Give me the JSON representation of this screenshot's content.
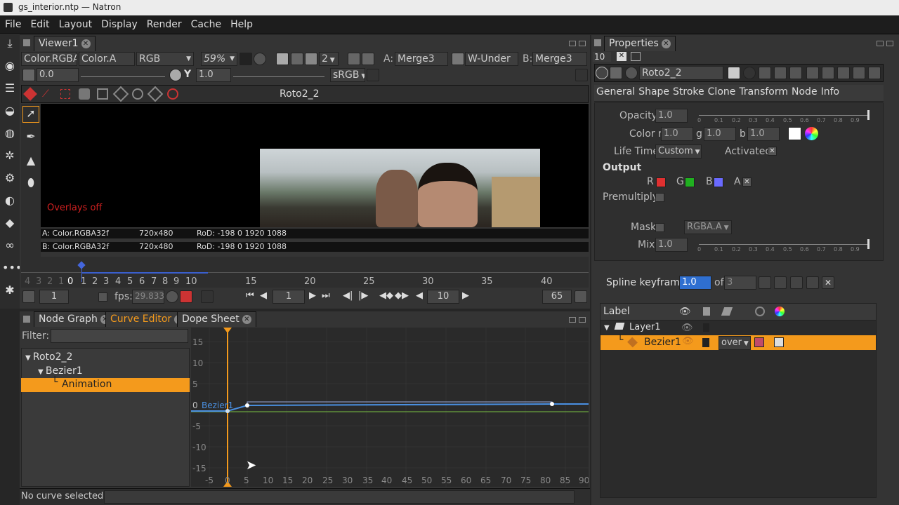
{
  "window": {
    "title": "gs_interior.ntp — Natron"
  },
  "menu": [
    "File",
    "Edit",
    "Layout",
    "Display",
    "Render",
    "Cache",
    "Help"
  ],
  "viewer": {
    "tab": "Viewer1",
    "channels_a": "Color.RGBA",
    "channels_b": "Color.A",
    "display_mode": "RGB",
    "zoom": "59%",
    "proxy": "2",
    "input_a_label": "A:",
    "input_a": "Merge3",
    "composite": "W-Under",
    "input_b_label": "B:",
    "input_b": "Merge3",
    "gain": "0.0",
    "gamma_label": "Y",
    "gamma": "1.0",
    "colorspace": "sRGB",
    "roto_node": "Roto2_2",
    "overlays": "Overlays off",
    "info_a": "A: Color.RGBA32f",
    "info_a_size": "720x480",
    "info_a_rod": "RoD: -198 0 1920 1088",
    "info_b": "B: Color.RGBA32f",
    "info_b_size": "720x480",
    "info_b_rod": "RoD: -198 0 1920 1088"
  },
  "timeline": {
    "ticks": [
      "4",
      "3",
      "2",
      "1",
      "0",
      "1",
      "2",
      "3",
      "4",
      "5",
      "6",
      "7",
      "8",
      "9",
      "10",
      "15",
      "20",
      "25",
      "30",
      "35",
      "40"
    ],
    "start": "1",
    "fps_label": "fps:",
    "fps": "29.833",
    "current": "1",
    "increment": "10",
    "end": "65"
  },
  "bottom_tabs": {
    "node_graph": "Node Graph",
    "curve_editor": "Curve Editor",
    "dope_sheet": "Dope Sheet"
  },
  "curve_editor": {
    "filter_label": "Filter:",
    "tree": [
      "Roto2_2",
      "Bezier1",
      "Animation"
    ],
    "curve_name": "Bezier1",
    "y_ticks": [
      "15",
      "10",
      "5",
      "0",
      "-5",
      "-10",
      "-15"
    ],
    "x_ticks": [
      "-5",
      "0",
      "5",
      "10",
      "15",
      "20",
      "25",
      "30",
      "35",
      "40",
      "45",
      "50",
      "55",
      "60",
      "65",
      "70",
      "75",
      "80",
      "85",
      "90"
    ],
    "status": "No curve selected"
  },
  "properties": {
    "tab": "Properties",
    "max_panels": "10",
    "node_name": "Roto2_2",
    "tabs": [
      "General",
      "Shape",
      "Stroke",
      "Clone",
      "Transform",
      "Node",
      "Info"
    ],
    "opacity_label": "Opacity",
    "opacity": "1.0",
    "color_label": "Color r",
    "color_r": "1.0",
    "g_label": "g",
    "color_g": "1.0",
    "b_label": "b",
    "color_b": "1.0",
    "lifetime_label": "Life Time",
    "lifetime": "Custom",
    "activated_label": "Activated",
    "output_label": "Output",
    "r_label": "R",
    "g2_label": "G",
    "b2_label": "B",
    "a_label": "A",
    "premultiply_label": "Premultiply",
    "mask_label": "Mask",
    "mask_channel": "RGBA.A",
    "mix_label": "Mix",
    "mix": "1.0",
    "slider_ticks": [
      "0",
      "0.1",
      "0.2",
      "0.3",
      "0.4",
      "0.5",
      "0.6",
      "0.7",
      "0.8",
      "0.9"
    ],
    "spline_keyframe_label": "Spline keyframe:",
    "spline_keyframe": "1.0",
    "of_label": "of",
    "spline_total": "3",
    "table_header": "Label",
    "layer": "Layer1",
    "bezier": "Bezier1",
    "blend_mode": "over"
  },
  "colors": {
    "accent": "#f49a1c",
    "selection": "#f49a1c",
    "curve": "#4a90e2",
    "r": "#e03030",
    "g": "#20b020",
    "b": "#6a6aff"
  }
}
